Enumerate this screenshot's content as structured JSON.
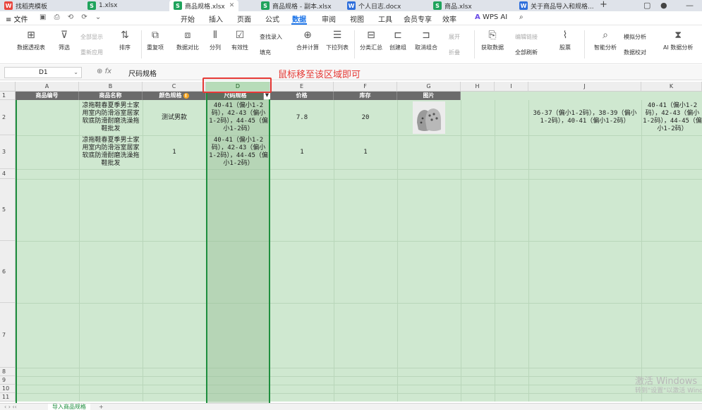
{
  "tabs": [
    {
      "icon": "W",
      "label": "找稻壳模板"
    },
    {
      "icon": "S",
      "label": "1.xlsx"
    },
    {
      "icon": "S",
      "label": "商品规格.xlsx"
    },
    {
      "icon": "S",
      "label": "商品规格 - 副本.xlsx"
    },
    {
      "icon": "W",
      "label": "个人日志.docx"
    },
    {
      "icon": "S",
      "label": "商品.xlsx"
    },
    {
      "icon": "W",
      "label": "关于商品导入和规格..."
    }
  ],
  "menu": {
    "file": "≡ 文件",
    "items": [
      "开始",
      "插入",
      "页面",
      "公式",
      "数据",
      "审阅",
      "视图",
      "工具",
      "会员专享",
      "效率"
    ],
    "active": "数据",
    "wps_ai": "WPS AI"
  },
  "ribbon": {
    "pivot": "数据透视表",
    "filter": "筛选",
    "show_all": "全部显示",
    "reapply": "重新应用",
    "sort": "排序",
    "duplicates": "重复项",
    "compare": "数据对比",
    "split": "分列",
    "validity": "有效性",
    "find_entry": "查找录入",
    "fill": "填充",
    "consolidate": "合并计算",
    "dropdown": "下拉列表",
    "subtotal": "分类汇总",
    "create_group": "创建组",
    "ungroup": "取消组合",
    "expand": "展开",
    "collapse": "折叠",
    "get_data": "获取数据",
    "edit_links": "编辑链接",
    "refresh_all": "全部刷新",
    "stock": "股票",
    "smart_analysis": "智能分析",
    "whatif": "模拟分析",
    "data_check": "数据校对",
    "ai_analysis": "AI 数据分析"
  },
  "formula_bar": {
    "cell_ref": "D1",
    "fx": "fx",
    "value": "尺码规格"
  },
  "annotation": "鼠标移至该区域即可",
  "columns": [
    "A",
    "B",
    "C",
    "D",
    "E",
    "F",
    "G",
    "H",
    "I",
    "J",
    "K"
  ],
  "rows": [
    "1",
    "2",
    "3",
    "4",
    "5",
    "6",
    "7",
    "8",
    "9",
    "10",
    "11"
  ],
  "header_row": [
    "商品编号",
    "商品名称",
    "颜色规格",
    "尺码规格",
    "价格",
    "库存",
    "图片"
  ],
  "data_rows": [
    {
      "name": "凉拖鞋春夏季男士家用室内防滑浴室居家软底防滑耐磨洗澡拖鞋批发",
      "color": "测试男款",
      "size": "40-41（偏小1-2码），42-43（偏小1-2码），44-45（偏小1-2码）",
      "price": "7.8",
      "stock": "20",
      "j": "36-37（偏小1-2码），38-39（偏小1-2码），40-41（偏小1-2码）",
      "k": "40-41（偏小1-2码），42-43（偏小1-2码），44-45（偏小1-2码）"
    },
    {
      "name": "凉拖鞋春夏季男士家用室内防滑浴室居家软底防滑耐磨洗澡拖鞋批发",
      "color": "1",
      "size": "40-41（偏小1-2码），42-43（偏小1-2码），44-45（偏小1-2码）",
      "price": "1",
      "stock": "1"
    }
  ],
  "sheet_tab": "导入商品规格",
  "watermark": {
    "line1": "激活 Windows",
    "line2": "转到\"设置\"以激活 Windows。"
  },
  "colors": {
    "accent": "#1a73e8",
    "selection": "#1e8e3e",
    "annotation": "#e53935",
    "grid_fill": "#cfe8d0"
  }
}
